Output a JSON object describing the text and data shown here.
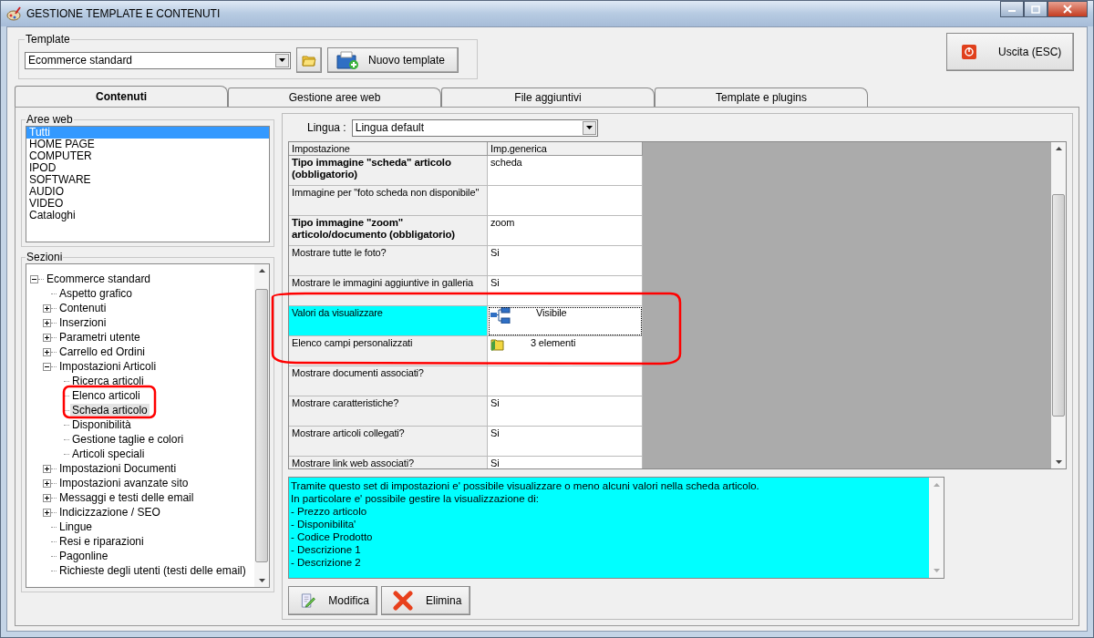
{
  "window": {
    "title": "GESTIONE TEMPLATE E CONTENUTI"
  },
  "template": {
    "legend": "Template",
    "value": "Ecommerce standard",
    "new_button": "Nuovo template"
  },
  "exit_button": "Uscita (ESC)",
  "tabs": [
    {
      "label": "Contenuti",
      "selected": true
    },
    {
      "label": "Gestione aree web",
      "selected": false
    },
    {
      "label": "File aggiuntivi",
      "selected": false
    },
    {
      "label": "Template e plugins",
      "selected": false
    }
  ],
  "web_areas": {
    "legend": "Aree web",
    "items": [
      {
        "label": "Tutti",
        "selected": true
      },
      {
        "label": "HOME PAGE",
        "selected": false
      },
      {
        "label": "COMPUTER",
        "selected": false
      },
      {
        "label": "IPOD",
        "selected": false
      },
      {
        "label": "SOFTWARE",
        "selected": false
      },
      {
        "label": "AUDIO",
        "selected": false
      },
      {
        "label": "VIDEO",
        "selected": false
      },
      {
        "label": "Cataloghi",
        "selected": false
      }
    ]
  },
  "sections": {
    "legend": "Sezioni",
    "tree": [
      {
        "label": "Ecommerce standard",
        "expanded": true,
        "selected": false,
        "children": [
          {
            "label": "Aspetto grafico",
            "selected": false
          },
          {
            "label": "Contenuti",
            "expanded": false,
            "selected": false
          },
          {
            "label": "Inserzioni",
            "expanded": false,
            "selected": false
          },
          {
            "label": "Parametri utente",
            "expanded": false,
            "selected": false
          },
          {
            "label": "Carrello ed Ordini",
            "expanded": false,
            "selected": false
          },
          {
            "label": "Impostazioni Articoli",
            "expanded": true,
            "selected": false,
            "children": [
              {
                "label": "Ricerca articoli",
                "selected": false
              },
              {
                "label": "Elenco articoli",
                "selected": false
              },
              {
                "label": "Scheda articolo",
                "selected": true
              },
              {
                "label": "Disponibilità",
                "selected": false
              },
              {
                "label": "Gestione taglie e colori",
                "selected": false
              },
              {
                "label": "Articoli speciali",
                "selected": false
              }
            ]
          },
          {
            "label": "Impostazioni Documenti",
            "expanded": false,
            "selected": false
          },
          {
            "label": "Impostazioni avanzate sito",
            "expanded": false,
            "selected": false
          },
          {
            "label": "Messaggi e testi delle email",
            "expanded": false,
            "selected": false
          },
          {
            "label": "Indicizzazione / SEO",
            "expanded": false,
            "selected": false
          },
          {
            "label": "Lingue",
            "selected": false
          },
          {
            "label": "Resi e riparazioni",
            "selected": false
          },
          {
            "label": "Pagonline",
            "selected": false
          },
          {
            "label": "Richieste degli utenti (testi delle email)",
            "selected": false
          }
        ]
      }
    ]
  },
  "language": {
    "label": "Lingua :",
    "value": "Lingua default"
  },
  "grid": {
    "columns": [
      "Impostazione",
      "Imp.generica"
    ],
    "rows": [
      {
        "setting": "Tipo immagine \"scheda\" articolo (obbligatorio)",
        "value": "scheda",
        "bold": true,
        "selected": false
      },
      {
        "setting": "Immagine per \"foto scheda non disponibile\"",
        "value": "",
        "bold": false,
        "selected": false
      },
      {
        "setting": "Tipo immagine \"zoom\" articolo/documento (obbligatorio)",
        "value": "zoom",
        "bold": true,
        "selected": false
      },
      {
        "setting": "Mostrare tutte le foto?",
        "value": "Si",
        "bold": false,
        "selected": false
      },
      {
        "setting": "Mostrare le immagini aggiuntive in galleria",
        "value": "Si",
        "bold": false,
        "selected": false
      },
      {
        "setting": "Valori da visualizzare",
        "value": "Visibile",
        "bold": false,
        "selected": true,
        "kind": "tree"
      },
      {
        "setting": "Elenco campi personalizzati",
        "value": "3 elementi",
        "bold": false,
        "selected": false,
        "kind": "folder"
      },
      {
        "setting": "Mostrare documenti associati?",
        "value": "",
        "bold": false,
        "selected": false
      },
      {
        "setting": "Mostrare caratteristiche?",
        "value": "Si",
        "bold": false,
        "selected": false
      },
      {
        "setting": "Mostrare articoli collegati?",
        "value": "Si",
        "bold": false,
        "selected": false
      },
      {
        "setting": "Mostrare link web associati?",
        "value": "Si",
        "bold": false,
        "selected": false
      }
    ]
  },
  "description": [
    "Tramite questo set di impostazioni e' possibile visualizzare o meno alcuni valori nella scheda articolo.",
    "In particolare e' possibile gestire la visualizzazione di:",
    "- Prezzo articolo",
    "- Disponibilita'",
    "- Codice Prodotto",
    "- Descrizione 1",
    "- Descrizione 2"
  ],
  "buttons": [
    {
      "label": "Modifica",
      "kind": "edit"
    },
    {
      "label": "Elimina",
      "kind": "delete"
    }
  ]
}
